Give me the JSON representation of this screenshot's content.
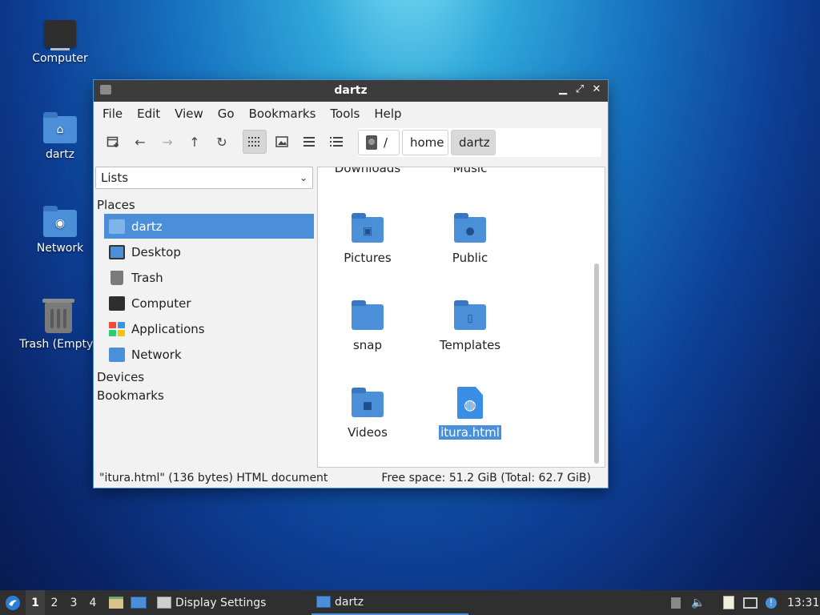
{
  "desktop": {
    "icons": [
      {
        "label": "Computer"
      },
      {
        "label": "dartz"
      },
      {
        "label": "Network"
      },
      {
        "label": "Trash (Empty)"
      }
    ]
  },
  "window": {
    "title": "dartz",
    "controls": {
      "minimize": "▁",
      "maximize": "⤢",
      "close": "✕"
    },
    "menu": [
      "File",
      "Edit",
      "View",
      "Go",
      "Bookmarks",
      "Tools",
      "Help"
    ],
    "breadcrumb": [
      "/",
      "home",
      "dartz"
    ],
    "sidebar": {
      "select_value": "Lists",
      "places_header": "Places",
      "places": [
        "dartz",
        "Desktop",
        "Trash",
        "Computer",
        "Applications",
        "Network"
      ],
      "devices_header": "Devices",
      "bookmarks_header": "Bookmarks"
    },
    "files": {
      "partial_top": [
        "Downloads",
        "Music"
      ],
      "items": [
        {
          "name": "Pictures",
          "icon": "image-icon"
        },
        {
          "name": "Public",
          "icon": "person-icon"
        },
        {
          "name": "snap",
          "icon": "folder-icon"
        },
        {
          "name": "Templates",
          "icon": "template-icon"
        },
        {
          "name": "Videos",
          "icon": "video-icon"
        },
        {
          "name": "itura.html",
          "icon": "html-file-icon"
        }
      ]
    },
    "status": {
      "left": "\"itura.html\" (136 bytes) HTML document",
      "right": "Free space: 51.2 GiB (Total: 62.7 GiB)"
    }
  },
  "taskbar": {
    "workspaces": [
      "1",
      "2",
      "3",
      "4"
    ],
    "tasks": [
      "Display Settings",
      "dartz"
    ],
    "clock": "13:31"
  },
  "colors": {
    "accent": "#4a8fd8",
    "titlebar": "#3c3c3c",
    "taskbar": "#2f2f2f"
  }
}
